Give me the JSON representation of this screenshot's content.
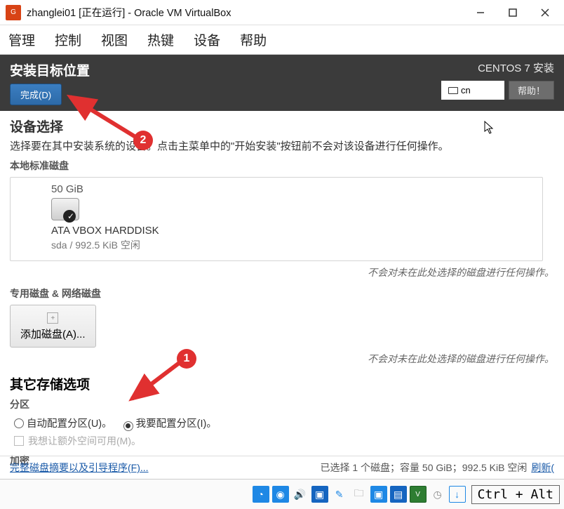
{
  "window": {
    "title": "zhanglei01 [正在运行] - Oracle VM VirtualBox"
  },
  "menubar": [
    "管理",
    "控制",
    "视图",
    "热键",
    "设备",
    "帮助"
  ],
  "header": {
    "title": "安装目标位置",
    "done": "完成(D)",
    "subtitle": "CENTOS 7 安装",
    "locale": "cn",
    "help": "帮助！"
  },
  "device": {
    "section": "设备选择",
    "hint": "选择要在其中安装系统的设备。点击主菜单中的\"开始安装\"按钮前不会对该设备进行任何操作。",
    "local_heading": "本地标准磁盘",
    "capacity": "50 GiB",
    "disk_name": "ATA VBOX HARDDISK",
    "disk_sub": "sda  /  992.5 KiB 空闲",
    "note": "不会对未在此处选择的磁盘进行任何操作。",
    "special_heading": "专用磁盘 & 网络磁盘",
    "add_disk": "添加磁盘(A)..."
  },
  "storage": {
    "section": "其它存储选项",
    "partition_label": "分区",
    "auto": "自动配置分区(U)。",
    "manual": "我要配置分区(I)。",
    "extra_space": "我想让额外空间可用(M)。",
    "encrypt_label": "加密"
  },
  "bottom": {
    "link": "完整磁盘摘要以及引导程序(F)...",
    "status": "已选择 1 个磁盘；容量 50 GiB；992.5 KiB 空闲",
    "refresh": "刷新("
  },
  "hostkey": "Ctrl + Alt",
  "annotations": {
    "badge1": "1",
    "badge2": "2"
  }
}
